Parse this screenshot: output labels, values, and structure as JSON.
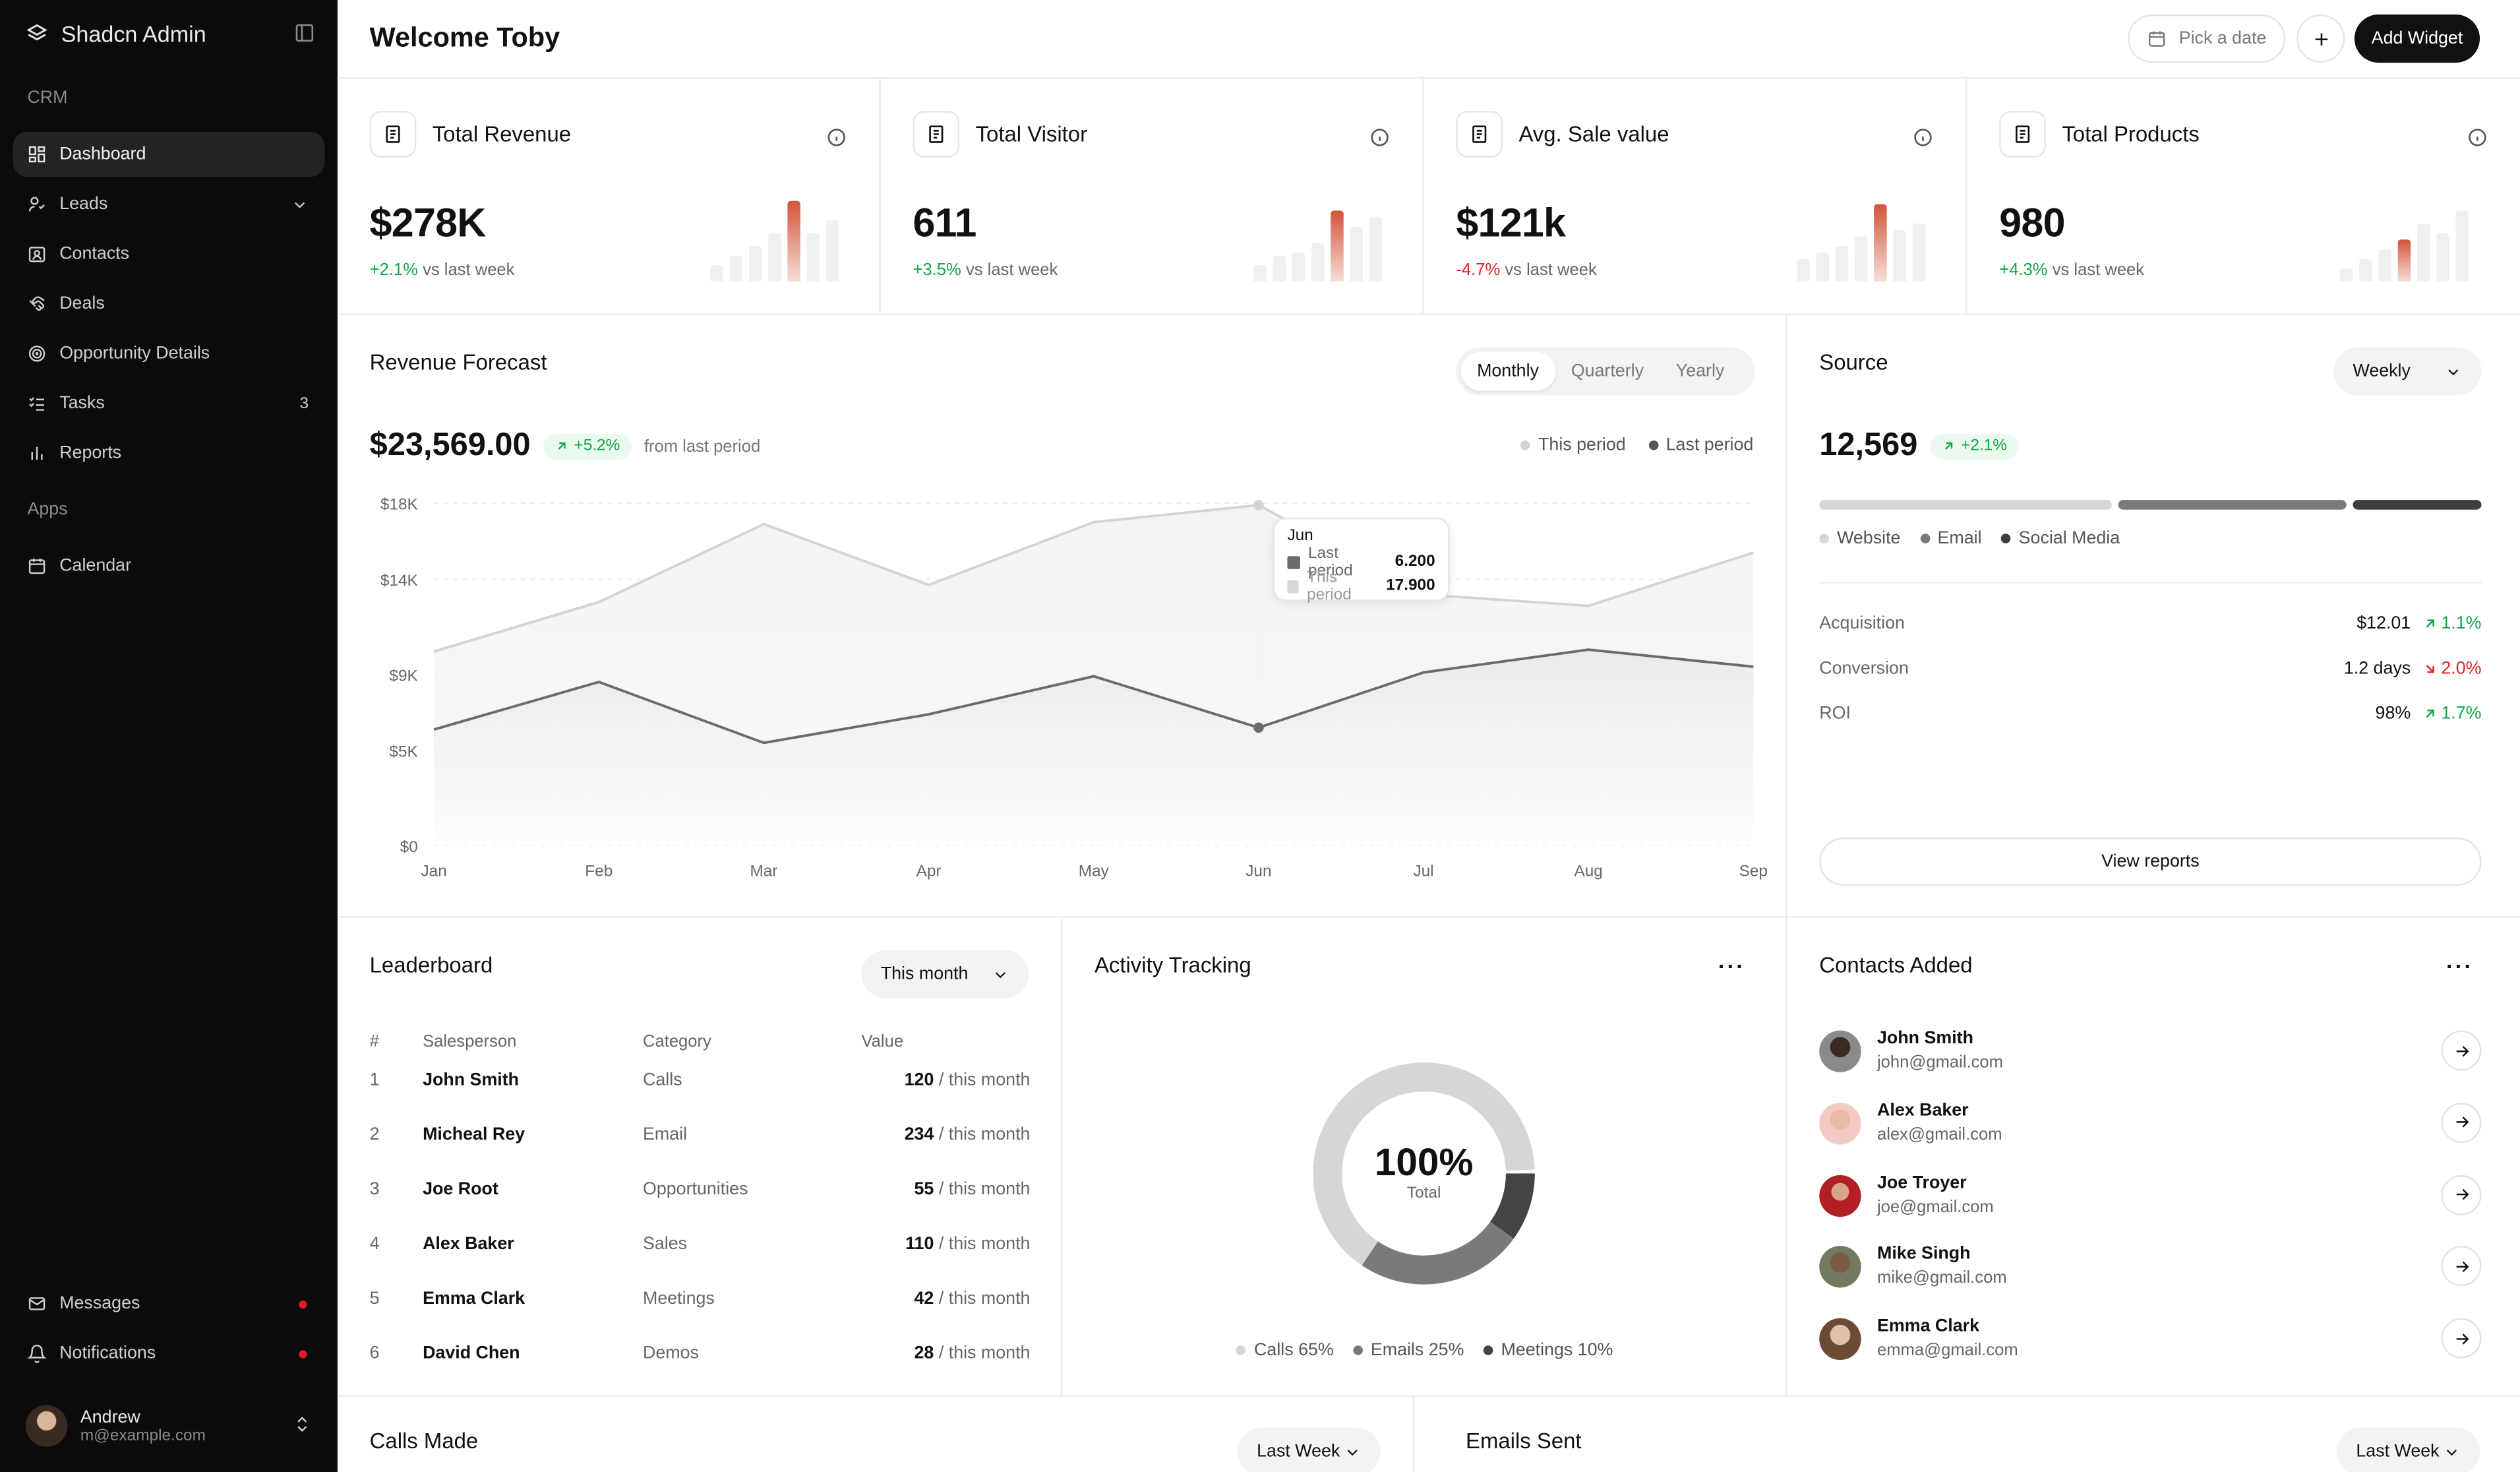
{
  "sidebar": {
    "brand": "Shadcn Admin",
    "section_crm": "CRM",
    "section_apps": "Apps",
    "items": [
      {
        "label": "Dashboard",
        "icon": "dashboard-icon",
        "active": true
      },
      {
        "label": "Leads",
        "icon": "leads-icon",
        "right": "chevron"
      },
      {
        "label": "Contacts",
        "icon": "contacts-icon"
      },
      {
        "label": "Deals",
        "icon": "deals-icon"
      },
      {
        "label": "Opportunity Details",
        "icon": "target-icon"
      },
      {
        "label": "Tasks",
        "icon": "tasks-icon",
        "badge": "3"
      },
      {
        "label": "Reports",
        "icon": "reports-icon"
      },
      {
        "label": "Calendar",
        "icon": "calendar-icon"
      },
      {
        "label": "Messages",
        "icon": "mail-icon"
      },
      {
        "label": "Notifications",
        "icon": "bell-icon"
      }
    ],
    "user": {
      "name": "Andrew",
      "email": "m@example.com"
    }
  },
  "header": {
    "title": "Welcome Toby",
    "date_placeholder": "Pick a date",
    "add_widget": "Add Widget"
  },
  "stats": [
    {
      "title": "Total Revenue",
      "value": "$278K",
      "delta": "+2.1%",
      "delta_suffix": "vs last week",
      "trend": "up"
    },
    {
      "title": "Total Visitor",
      "value": "611",
      "delta": "+3.5%",
      "delta_suffix": "vs last week",
      "trend": "up"
    },
    {
      "title": "Avg. Sale value",
      "value": "$121k",
      "delta": "-4.7%",
      "delta_suffix": "vs last week",
      "trend": "down"
    },
    {
      "title": "Total Products",
      "value": "980",
      "delta": "+4.3%",
      "delta_suffix": "vs last week",
      "trend": "up"
    }
  ],
  "forecast": {
    "title": "Revenue Forecast",
    "tabs": [
      "Monthly",
      "Quarterly",
      "Yearly"
    ],
    "active_tab": "Monthly",
    "total": "$23,569.00",
    "change": "+5.2%",
    "change_suffix": "from last period",
    "legend": [
      "This period",
      "Last period"
    ],
    "tooltip": {
      "month": "Jun",
      "rows": [
        {
          "label": "Last period",
          "value": "6.200"
        },
        {
          "label": "This period",
          "value": "17.900"
        }
      ]
    }
  },
  "chart_data": {
    "type": "area",
    "x": [
      "Jan",
      "Feb",
      "Mar",
      "Apr",
      "May",
      "Jun",
      "Jul",
      "Aug",
      "Sep"
    ],
    "y_ticks": [
      "$0",
      "$5K",
      "$9K",
      "$14K",
      "$18K"
    ],
    "ylim": [
      0,
      18000
    ],
    "series": [
      {
        "name": "This period",
        "color": "#d4d4d4",
        "values": [
          10200,
          12800,
          16900,
          13700,
          17000,
          17900,
          13200,
          12600,
          15400
        ]
      },
      {
        "name": "Last period",
        "color": "#6b6b6b",
        "values": [
          6100,
          8600,
          5400,
          6900,
          8900,
          6200,
          9100,
          10300,
          9400
        ]
      }
    ]
  },
  "source": {
    "title": "Source",
    "period": "Weekly",
    "total": "12,569",
    "change": "+2.1%",
    "legend": [
      "Website",
      "Email",
      "Social Media"
    ],
    "metrics": [
      {
        "label": "Acquisition",
        "value": "$12.01",
        "delta": "1.1%",
        "trend": "up"
      },
      {
        "label": "Conversion",
        "value": "1.2 days",
        "delta": "2.0%",
        "trend": "down"
      },
      {
        "label": "ROI",
        "value": "98%",
        "delta": "1.7%",
        "trend": "up"
      }
    ],
    "button": "View reports"
  },
  "leaderboard": {
    "title": "Leaderboard",
    "period": "This month",
    "headers": [
      "#",
      "Salesperson",
      "Category",
      "Value"
    ],
    "rows": [
      {
        "n": "1",
        "name": "John Smith",
        "category": "Calls",
        "value": "120",
        "suffix": "/ this month"
      },
      {
        "n": "2",
        "name": "Micheal Rey",
        "category": "Email",
        "value": "234",
        "suffix": "/ this month"
      },
      {
        "n": "3",
        "name": "Joe Root",
        "category": "Opportunities",
        "value": "55",
        "suffix": "/ this month"
      },
      {
        "n": "4",
        "name": "Alex Baker",
        "category": "Sales",
        "value": "110",
        "suffix": "/ this month"
      },
      {
        "n": "5",
        "name": "Emma Clark",
        "category": "Meetings",
        "value": "42",
        "suffix": "/ this month"
      },
      {
        "n": "6",
        "name": "David Chen",
        "category": "Demos",
        "value": "28",
        "suffix": "/ this month"
      }
    ]
  },
  "activity": {
    "title": "Activity Tracking",
    "center_value": "100%",
    "center_label": "Total",
    "legend": [
      "Calls 65%",
      "Emails 25%",
      "Meetings 10%"
    ]
  },
  "activity_chart": {
    "type": "pie",
    "labels": [
      "Calls",
      "Emails",
      "Meetings"
    ],
    "values": [
      65,
      25,
      10
    ],
    "colors": [
      "#d6d6d6",
      "#7a7a7a",
      "#444444"
    ]
  },
  "contacts": {
    "title": "Contacts Added",
    "items": [
      {
        "name": "John Smith",
        "email": "john@gmail.com"
      },
      {
        "name": "Alex Baker",
        "email": "alex@gmail.com"
      },
      {
        "name": "Joe Troyer",
        "email": "joe@gmail.com"
      },
      {
        "name": "Mike Singh",
        "email": "mike@gmail.com"
      },
      {
        "name": "Emma Clark",
        "email": "emma@gmail.com"
      }
    ]
  },
  "calls": {
    "title": "Calls Made",
    "period": "Last Week"
  },
  "emails": {
    "title": "Emails Sent",
    "period": "Last Week"
  },
  "colors": {
    "positive": "#16a34a",
    "negative": "#dc2626",
    "accent_bar": "#d2553a",
    "dark": "#111111"
  }
}
